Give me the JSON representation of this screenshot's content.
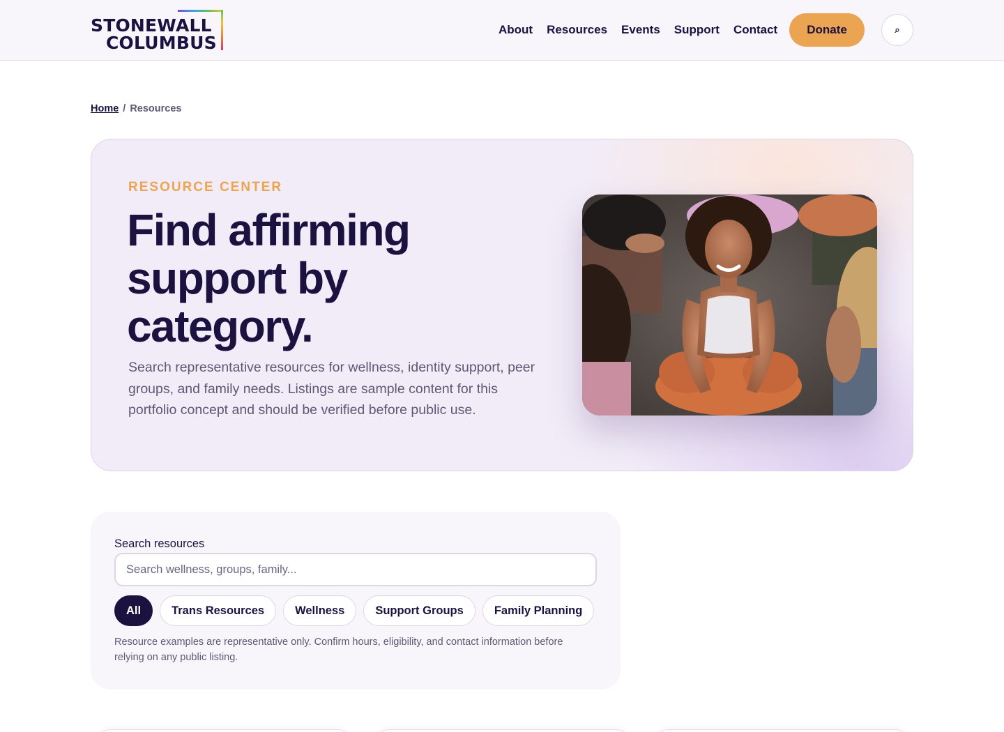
{
  "header": {
    "logo": {
      "line1": "STONEWALL",
      "line2": "COLUMBUS"
    },
    "nav": [
      {
        "label": "About"
      },
      {
        "label": "Resources"
      },
      {
        "label": "Events"
      },
      {
        "label": "Support"
      },
      {
        "label": "Contact"
      }
    ],
    "donate_label": "Donate",
    "search_icon": "search-icon",
    "search_glyph": "⌕"
  },
  "breadcrumb": {
    "home": "Home",
    "separator": "/",
    "current": "Resources"
  },
  "hero": {
    "eyebrow": "RESOURCE CENTER",
    "title": "Find affirming support by category.",
    "description": "Search representative resources for wellness, identity support, peer groups, and family needs. Listings are sample content for this portfolio concept and should be verified before public use.",
    "image": "photo-group-yoga-class"
  },
  "search": {
    "label": "Search resources",
    "placeholder": "Search wellness, groups, family...",
    "value": "",
    "filters": [
      {
        "label": "All",
        "active": true
      },
      {
        "label": "Trans Resources",
        "active": false
      },
      {
        "label": "Wellness",
        "active": false
      },
      {
        "label": "Support Groups",
        "active": false
      },
      {
        "label": "Family Planning",
        "active": false
      }
    ],
    "note": "Resource examples are representative only. Confirm hours, eligibility, and contact information before relying on any public listing."
  },
  "colors": {
    "brand_navy": "#1c1240",
    "accent_orange": "#eba451",
    "hero_lavender": "#f2ecf8",
    "muted_text": "#5e5874"
  }
}
